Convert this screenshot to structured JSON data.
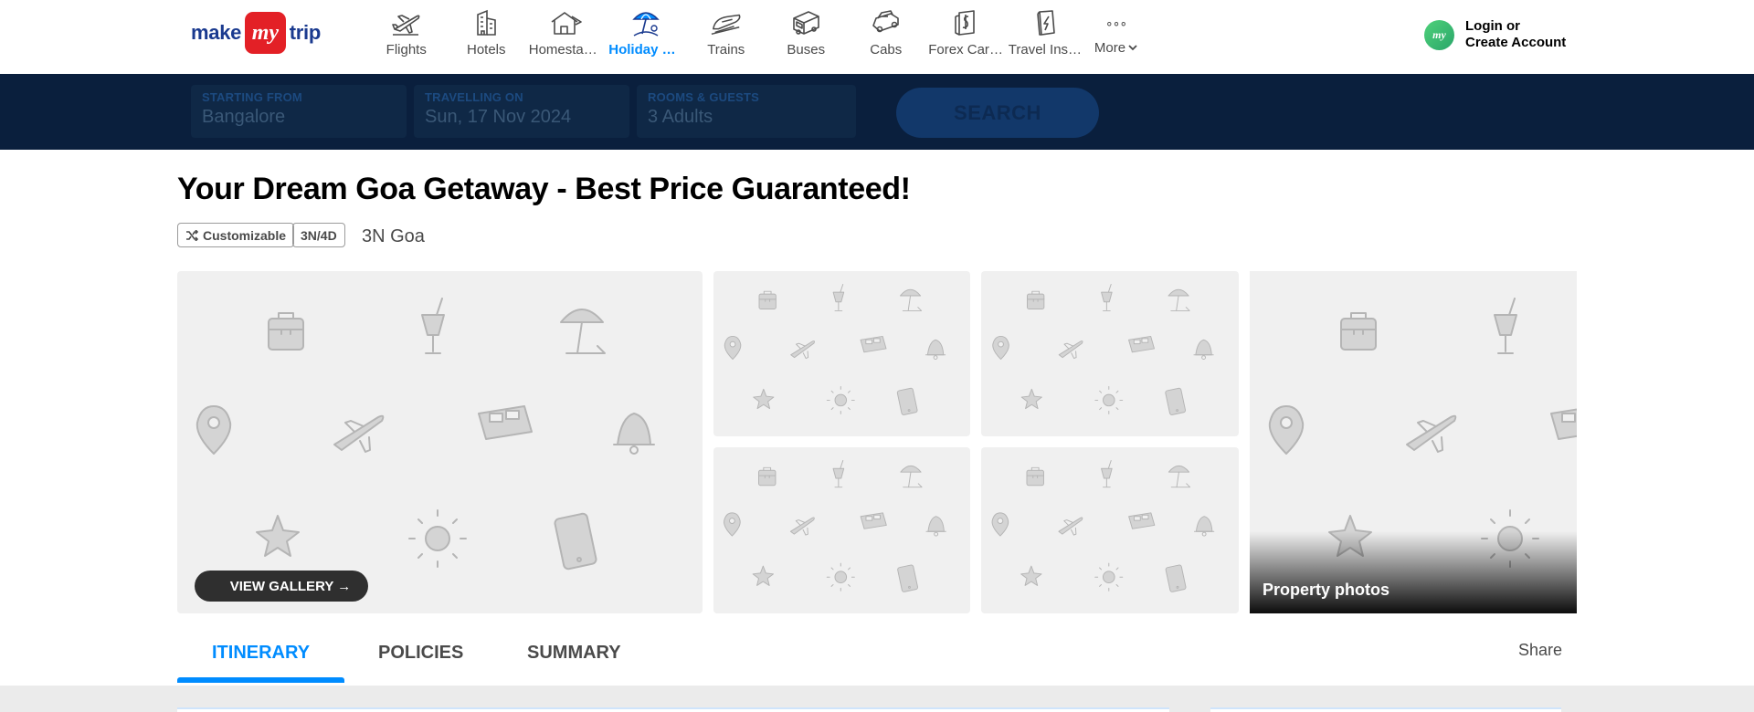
{
  "brand": {
    "make": "make",
    "my": "my",
    "trip": "trip",
    "color": "#e32026"
  },
  "nav": {
    "items": [
      {
        "label": "Flights",
        "icon": "flight-icon",
        "active": false
      },
      {
        "label": "Hotels",
        "icon": "hotel-icon",
        "active": false
      },
      {
        "label": "Homestays & Villas",
        "icon": "homestay-icon",
        "active": false
      },
      {
        "label": "Holiday Packages",
        "icon": "holiday-icon",
        "active": true
      },
      {
        "label": "Trains",
        "icon": "train-icon",
        "active": false
      },
      {
        "label": "Buses",
        "icon": "bus-icon",
        "active": false
      },
      {
        "label": "Cabs",
        "icon": "cab-icon",
        "active": false
      },
      {
        "label": "Forex Card & Currency",
        "icon": "forex-icon",
        "active": false
      },
      {
        "label": "Travel Insurance",
        "icon": "insurance-icon",
        "active": false
      }
    ],
    "more": {
      "label": "More",
      "dots": "∘∘∘"
    }
  },
  "login": {
    "line1": "Login or",
    "line2": "Create Account",
    "avatar": "my"
  },
  "search": {
    "fields": [
      {
        "label": "STARTING FROM",
        "value": "Bangalore"
      },
      {
        "label": "TRAVELLING ON",
        "value": "Sun, 17 Nov 2024"
      },
      {
        "label": "ROOMS & GUESTS",
        "value": "3 Adults"
      }
    ],
    "button": "SEARCH"
  },
  "package": {
    "title": "Your Dream Goa Getaway - Best Price Guaranteed!",
    "tags": [
      "Customizable",
      "3N/4D"
    ],
    "subtitle": "3N Goa"
  },
  "gallery": {
    "button": "VIEW GALLERY →",
    "property_label": "Property photos"
  },
  "tabs": [
    {
      "label": "ITINERARY",
      "active": true
    },
    {
      "label": "POLICIES",
      "active": false
    },
    {
      "label": "SUMMARY",
      "active": false
    }
  ],
  "share": "Share",
  "colors": {
    "accent": "#008cff",
    "header_band": "#0a1f3d",
    "placeholder_bg": "#f0f0f0"
  }
}
